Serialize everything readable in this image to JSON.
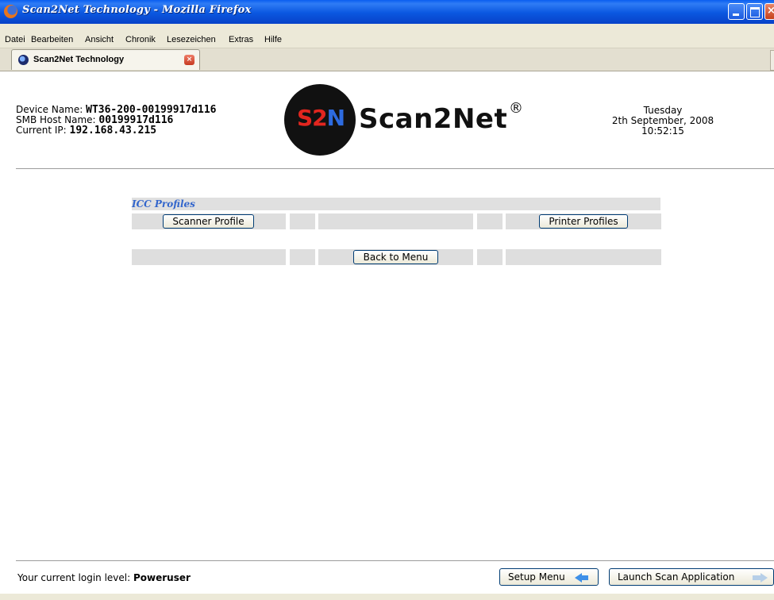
{
  "window": {
    "title": "Scan2Net Technology - Mozilla Firefox",
    "close_glyph": "×"
  },
  "menu": [
    "Datei",
    "Bearbeiten",
    "Ansicht",
    "Chronik",
    "Lesezeichen",
    "Extras",
    "Hilfe"
  ],
  "tab": {
    "label": "Scan2Net Technology",
    "close_glyph": "×"
  },
  "device": {
    "name_label": "Device Name: ",
    "name_value": "WT36-200-00199917d116",
    "smb_label": "SMB Host Name: ",
    "smb_value": "00199917d116",
    "ip_label": "Current IP: ",
    "ip_value": "192.168.43.215"
  },
  "logo": {
    "mark_s": "S",
    "mark_2": "2",
    "mark_n": "N",
    "word": "Scan2Net",
    "reg": "®"
  },
  "datetime": {
    "day": "Tuesday",
    "date": "2th September, 2008",
    "time": "10:52:15"
  },
  "icc": {
    "title": "ICC Profiles",
    "scanner_button": "Scanner Profile",
    "printer_button": "Printer Profiles",
    "back_button": "Back to Menu"
  },
  "footer": {
    "login_label": "Your current login level: ",
    "login_value": "Poweruser",
    "setup_button": "Setup Menu",
    "launch_button": "Launch Scan Application"
  },
  "colors": {
    "titlebar": "#0a57e0",
    "icc_title": "#3366cc",
    "cell_bg": "#dedede",
    "logo_red": "#e2261f",
    "logo_blue": "#2d6be0"
  }
}
